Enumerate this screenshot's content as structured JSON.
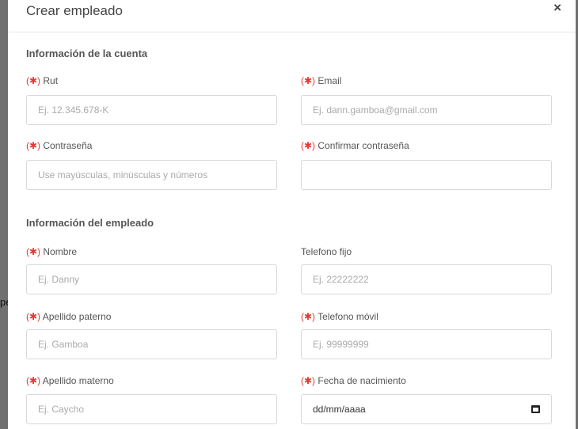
{
  "modal": {
    "title": "Crear empleado",
    "close_label": "×"
  },
  "background": {
    "peek_text": "pe"
  },
  "sections": {
    "account_title": "Información de la cuenta",
    "employee_title": "Información del empleado"
  },
  "required_marker": "(✱)",
  "fields": {
    "rut": {
      "label": "Rut",
      "placeholder": "Ej. 12.345.678-K"
    },
    "email": {
      "label": "Email",
      "placeholder": "Ej. dann.gamboa@gmail.com"
    },
    "password": {
      "label": "Contraseña",
      "placeholder": "Use mayúsculas, minúsculas y números"
    },
    "confirm_password": {
      "label": "Confirmar contraseña",
      "placeholder": ""
    },
    "nombre": {
      "label": "Nombre",
      "placeholder": "Ej. Danny"
    },
    "telefono_fijo": {
      "label": "Telefono fijo",
      "placeholder": "Ej. 22222222"
    },
    "apellido_paterno": {
      "label": "Apellido paterno",
      "placeholder": "Ej. Gamboa"
    },
    "telefono_movil": {
      "label": "Telefono móvil",
      "placeholder": "Ej. 99999999"
    },
    "apellido_materno": {
      "label": "Apellido materno",
      "placeholder": "Ej. Caycho"
    },
    "fecha_nacimiento": {
      "label": "Fecha de nacimiento",
      "value": "dd/mm/aaaa",
      "icon": "calendar-icon"
    }
  },
  "colors": {
    "required": "#e53935"
  }
}
